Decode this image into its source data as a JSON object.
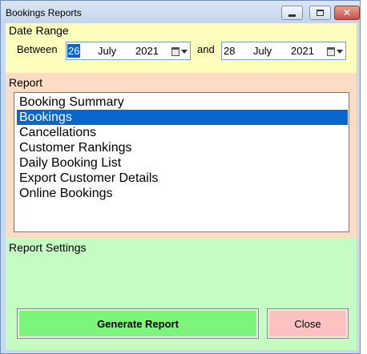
{
  "window": {
    "title": "Bookings Reports",
    "close_glyph": "✕"
  },
  "date_range": {
    "label": "Date Range",
    "between_label": "Between",
    "and_label": "and",
    "from": {
      "day": "26",
      "month": "July",
      "year": "2021"
    },
    "to": {
      "day": "28",
      "month": "July",
      "year": "2021"
    }
  },
  "report": {
    "label": "Report",
    "items": [
      "Booking Summary",
      "Bookings",
      "Cancellations",
      "Customer Rankings",
      "Daily Booking List",
      "Export Customer Details",
      "Online Bookings"
    ],
    "selected": "Bookings"
  },
  "settings": {
    "label": "Report Settings"
  },
  "buttons": {
    "generate": "Generate Report",
    "close": "Close"
  },
  "colors": {
    "date_range_bg": "#fffdbb",
    "report_bg": "#fcdcc2",
    "settings_bg": "#c4fcc4",
    "selection": "#0a66cc",
    "generate_bg": "#7df57a",
    "close_bg": "#fcc2c2"
  },
  "icons": [
    "minimize-icon",
    "maximize-icon",
    "close-icon",
    "calendar-icon",
    "chevron-down-icon"
  ]
}
